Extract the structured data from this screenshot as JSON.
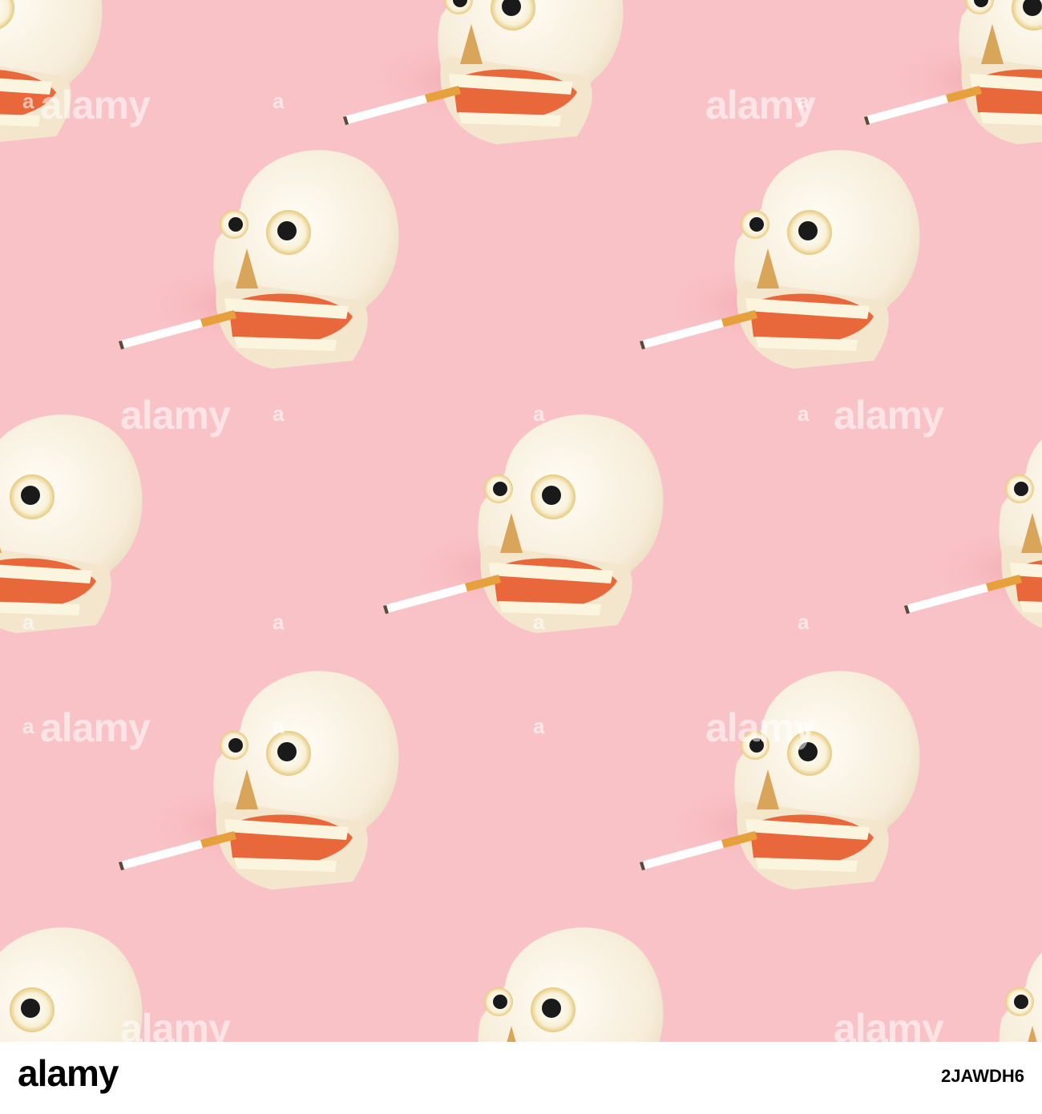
{
  "colors": {
    "background": "#f9c2c6",
    "skull": "#f7f0e2",
    "footer": "#ffffff"
  },
  "watermark": {
    "text": "alamy",
    "mark": "a"
  },
  "footer": {
    "logo_text": "alamy",
    "image_id": "2JAWDH6"
  },
  "objects": {
    "skull_name": "skull-with-cigarette",
    "count_visible_full": 5
  }
}
